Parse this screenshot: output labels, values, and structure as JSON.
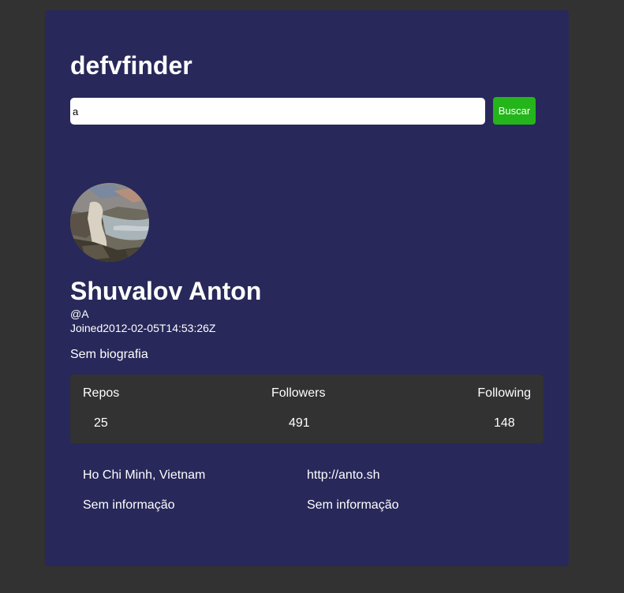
{
  "app": {
    "title": "defvfinder"
  },
  "search": {
    "value": "a",
    "button_label": "Buscar"
  },
  "profile": {
    "avatar_icon": "user-avatar-photo",
    "name": "Shuvalov Anton",
    "login": "@A",
    "joined_prefix": "Joined",
    "joined_date": "2012-02-05T14:53:26Z",
    "bio": "Sem biografia"
  },
  "stats": {
    "repos_label": "Repos",
    "repos_value": "25",
    "followers_label": "Followers",
    "followers_value": "491",
    "following_label": "Following",
    "following_value": "148"
  },
  "info": {
    "location": "Ho Chi Minh, Vietnam",
    "blog": "http://anto.sh",
    "twitter": "Sem informação",
    "company": "Sem informação"
  },
  "colors": {
    "page_background": "#323232",
    "card_background": "#28285a",
    "button_background": "#24b51a",
    "stats_background": "#323232",
    "text": "#ffffff"
  }
}
